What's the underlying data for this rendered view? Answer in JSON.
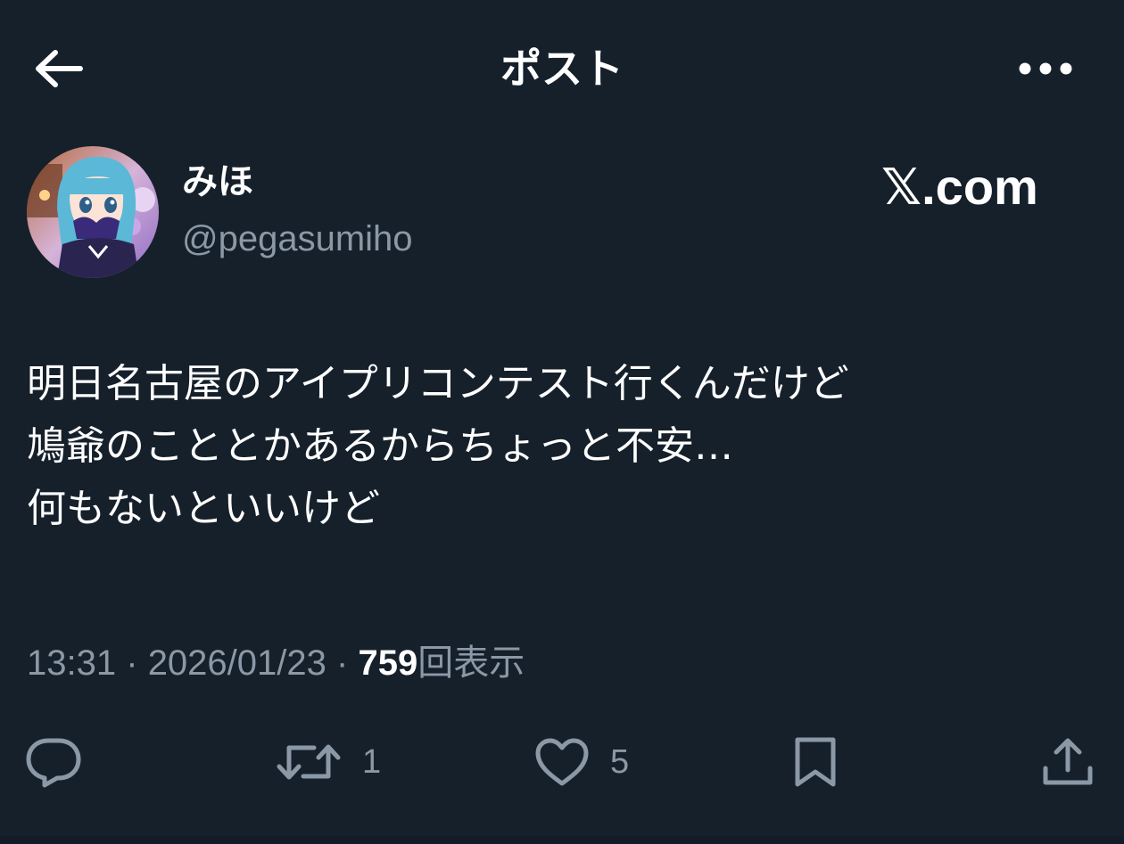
{
  "header": {
    "title": "ポスト",
    "back_icon": "arrow-left-icon",
    "more_icon": "more-horizontal-icon"
  },
  "author": {
    "display_name": "みほ",
    "handle": "@pegasumiho",
    "avatar": "avatar-illustration"
  },
  "watermark": "𝕏.com",
  "post": {
    "text": "明日名古屋のアイプリコンテスト行くんだけど\n鳩爺のこととかあるからちょっと不安…\n何もないといいけど"
  },
  "meta": {
    "time": "13:31",
    "separator": "·",
    "date": "2026/01/23",
    "views_count": "759",
    "views_label": "回表示"
  },
  "actions": {
    "reply": {
      "icon": "reply-icon",
      "count": ""
    },
    "repost": {
      "icon": "repost-icon",
      "count": "1"
    },
    "like": {
      "icon": "heart-icon",
      "count": "5"
    },
    "bookmark": {
      "icon": "bookmark-icon",
      "count": ""
    },
    "share": {
      "icon": "share-icon",
      "count": ""
    }
  },
  "colors": {
    "background": "#15202b",
    "primary_text": "#ffffff",
    "secondary_text": "#8b98a5"
  }
}
